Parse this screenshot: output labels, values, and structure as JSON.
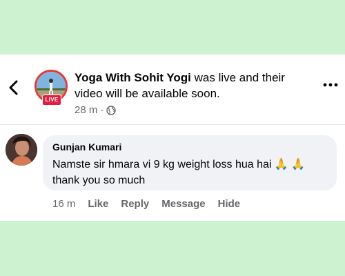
{
  "post": {
    "page_name": "Yoga With Sohit Yogi",
    "text": " was live and their video will be available soon.",
    "live_badge": "LIVE",
    "timestamp": "28 m",
    "separator": "·",
    "audience_icon": "globe-icon"
  },
  "icons": {
    "back": "chevron-left-icon",
    "more": "more-dots-icon"
  },
  "comment": {
    "author": "Gunjan Kumari",
    "text": "Namste sir hmara vi 9 kg weight loss hua hai 🙏 🙏thank you so much",
    "time": "16 m",
    "like_label": "Like",
    "reply_label": "Reply",
    "message_label": "Message",
    "hide_label": "Hide"
  },
  "colors": {
    "background": "#cdf2cf",
    "live_red": "#e41e3f",
    "muted_text": "#65676b",
    "bubble": "#f0f2f5"
  }
}
